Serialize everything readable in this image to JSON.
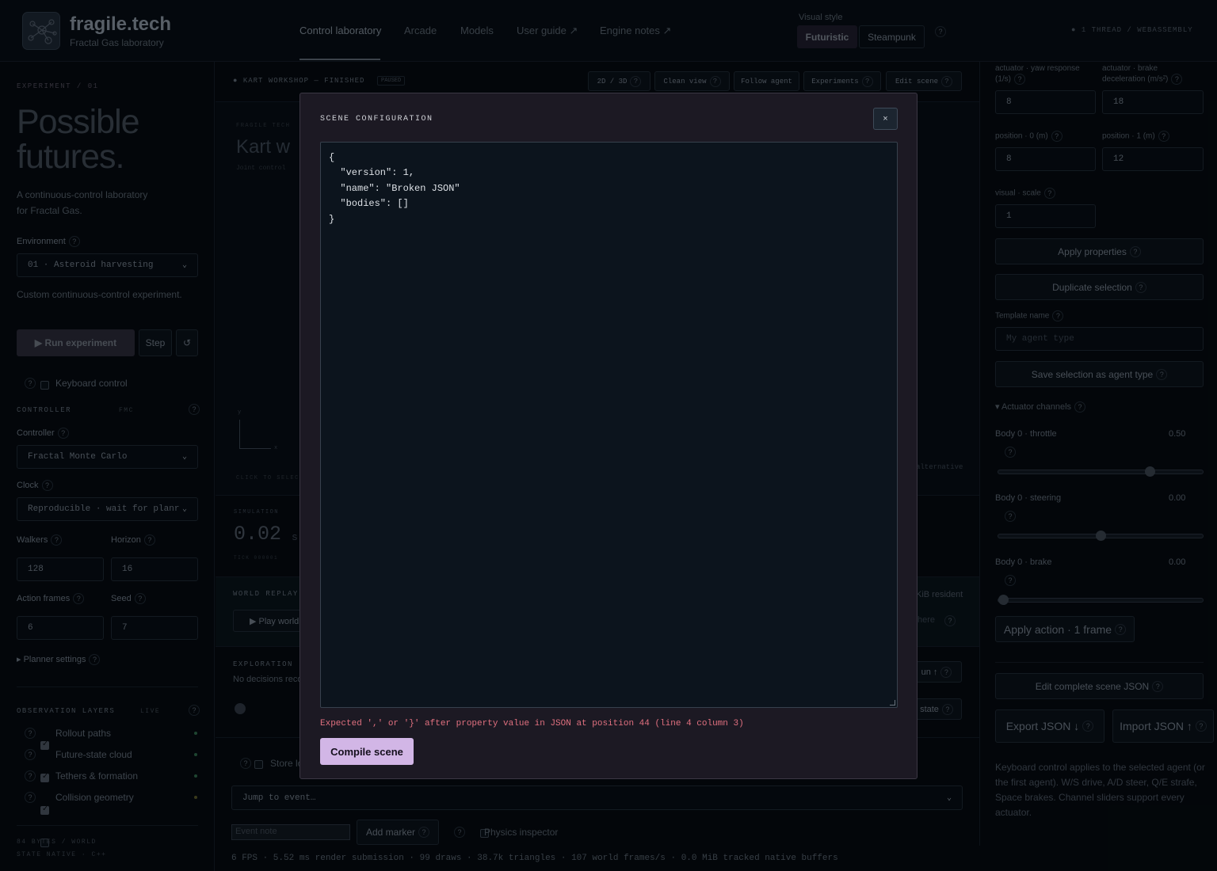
{
  "header": {
    "brand": "fragile.tech",
    "tagline": "Fractal Gas laboratory",
    "nav": [
      "Control laboratory",
      "Arcade",
      "Models",
      "User guide ↗",
      "Engine notes ↗"
    ],
    "visual_style_label": "Visual style",
    "style_options": [
      "Futuristic",
      "Steampunk"
    ],
    "selected_style": "Futuristic",
    "thread_info": "1 THREAD / WEBASSEMBLY"
  },
  "left": {
    "eyebrow": "EXPERIMENT / 01",
    "title_line1": "Possible",
    "title_line2": "futures.",
    "subtitle_line1": "A continuous-control laboratory",
    "subtitle_line2": "for Fractal Gas.",
    "environment_label": "Environment",
    "environment_value": "01 · Asteroid harvesting",
    "environment_desc": "Custom continuous-control experiment.",
    "run_label": "▶ Run experiment",
    "step_label": "Step",
    "reset_icon": "↺",
    "keyboard_label": "Keyboard control",
    "controller_heading": "CONTROLLER",
    "controller_tag": "FMC",
    "controller_label": "Controller",
    "controller_value": "Fractal Monte Carlo",
    "clock_label": "Clock",
    "clock_value": "Reproducible · wait for planr",
    "walkers_label": "Walkers",
    "walkers_value": "128",
    "horizon_label": "Horizon",
    "horizon_value": "16",
    "action_frames_label": "Action frames",
    "action_frames_value": "6",
    "seed_label": "Seed",
    "seed_value": "7",
    "planner_settings": "▸ Planner settings",
    "obs_heading": "OBSERVATION LAYERS",
    "obs_tag": "LIVE",
    "layers": [
      {
        "label": "Rollout paths",
        "checked": true,
        "color": "#2f6a4c"
      },
      {
        "label": "Future-state cloud",
        "checked": true,
        "color": "#2f6a4c"
      },
      {
        "label": "Tethers & formation",
        "checked": true,
        "color": "#2f6a4c"
      },
      {
        "label": "Collision geometry",
        "checked": false,
        "color": "#5a5a2a"
      }
    ],
    "footer_line1": "84 BYTES / WORLD",
    "footer_line2": "STATE NATIVE · C++"
  },
  "center": {
    "status": "KART WORKSHOP — FINISHED",
    "status_badge": "PAUSED",
    "toolbar": [
      "2D / 3D",
      "Clean view",
      "Follow agent",
      "Experiments",
      "Edit scene"
    ],
    "canvas_title": "Kart w",
    "canvas_eyebrow": "FRAGILE TECH",
    "canvas_sub": "Joint control",
    "axis_y": "y",
    "axis_x": "x",
    "click_hint": "CLICK TO SELECT",
    "alt_hint": "alternative",
    "sim_label": "SIMULATION",
    "sim_value": "0.02",
    "sim_unit": "s",
    "tick_label": "TICK 000001",
    "replay_heading": "WORLD REPLAY",
    "replay_resident": "KiB resident",
    "play_world": "▶ Play world",
    "replay_here": "here",
    "exploration_heading": "EXPLORATION",
    "no_decisions": "No decisions reco",
    "run_btn": "un ↑",
    "state_btn": "state",
    "store_label": "Store lo",
    "jump_value": "Jump to event…",
    "event_note_placeholder": "Event note",
    "add_marker": "Add marker",
    "physics_inspector": "Physics inspector",
    "perf": "6 FPS · 5.52 ms render submission · 99 draws · 38.7k triangles · 107 world frames/s · 0.0 MiB tracked native buffers"
  },
  "right": {
    "yaw_label": "actuator · yaw response (1/s)",
    "brake_decel_label": "actuator · brake deceleration (m/s²)",
    "yaw_value": "8",
    "brake_decel_value": "18",
    "pos0_label": "position · 0 (m)",
    "pos1_label": "position · 1 (m)",
    "pos0_value": "8",
    "pos1_value": "12",
    "scale_label": "visual · scale",
    "scale_value": "1",
    "apply_properties": "Apply properties",
    "duplicate_selection": "Duplicate selection",
    "template_label": "Template name",
    "template_placeholder": "My agent type",
    "save_agent_type": "Save selection as agent type",
    "actuator_channels": "▾ Actuator channels",
    "channels": [
      {
        "label": "Body 0 · throttle",
        "value": "0.50",
        "level": 0.75
      },
      {
        "label": "Body 0 · steering",
        "value": "0.00",
        "level": 0.5
      },
      {
        "label": "Body 0 · brake",
        "value": "0.00",
        "level": 0.0
      }
    ],
    "apply_action": "Apply action · 1 frame",
    "edit_json": "Edit complete scene JSON",
    "export_json": "Export JSON ↓",
    "import_json": "Import JSON ↑",
    "help_text": "Keyboard control applies to the selected agent (or the first agent). W/S drive, A/D steer, Q/E strafe, Space brakes. Channel sliders support every actuator."
  },
  "modal": {
    "title": "SCENE CONFIGURATION",
    "close_label": "×",
    "json_text": "{\n  \"version\": 1,\n  \"name\": \"Broken JSON\"\n  \"bodies\": []\n}",
    "error": "Expected ',' or '}' after property value in JSON at position 44 (line 4 column 3)",
    "compile_label": "Compile scene"
  }
}
